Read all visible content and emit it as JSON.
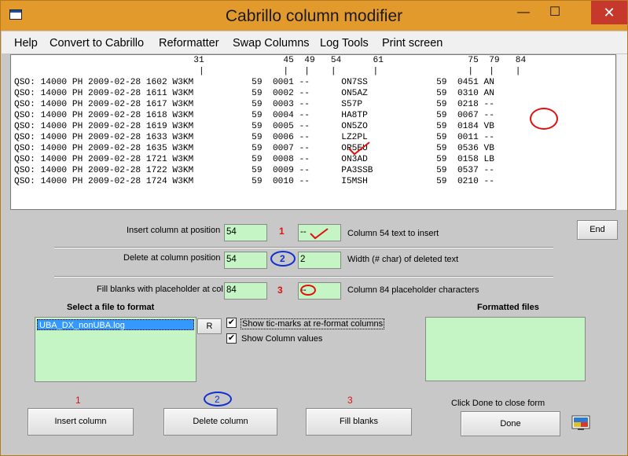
{
  "window": {
    "title": "Cabrillo column modifier",
    "minimize": "—",
    "maximize": "☐",
    "close": "✕"
  },
  "menu": [
    "Help",
    "Convert to Cabrillo",
    "Reformatter",
    "Swap Columns",
    "Log Tools",
    "Print screen"
  ],
  "log_header": [
    "                                  31               45  49   54      61                75  79   84",
    "                                   |               |   |    |       |                 |   |    |"
  ],
  "log_lines": [
    "QSO: 14000 PH 2009-02-28 1602 W3KM           59  0001 --      ON7SS             59  0451 AN",
    "QSO: 14000 PH 2009-02-28 1611 W3KM           59  0002 --      ON5AZ             59  0310 AN",
    "QSO: 14000 PH 2009-02-28 1617 W3KM           59  0003 --      S57P              59  0218 --",
    "QSO: 14000 PH 2009-02-28 1618 W3KM           59  0004 --      HA8TP             59  0067 --",
    "QSO: 14000 PH 2009-02-28 1619 W3KM           59  0005 --      ON5ZO             59  0184 VB",
    "QSO: 14000 PH 2009-02-28 1633 W3KM           59  0006 --      LZ2PL             59  0011 --",
    "QSO: 14000 PH 2009-02-28 1635 W3KM           59  0007 --      OR5EU             59  0536 VB",
    "QSO: 14000 PH 2009-02-28 1721 W3KM           59  0008 --      ON3AD             59  0158 LB",
    "QSO: 14000 PH 2009-02-28 1722 W3KM           59  0009 --      PA3SSB            59  0537 --",
    "QSO: 14000 PH 2009-02-28 1724 W3KM           59  0010 --      I5MSH             59  0210 --"
  ],
  "insert_row": {
    "label": "Insert column at position",
    "position": "54",
    "number": "1",
    "text_value": "--",
    "caption": "Column 54 text to insert"
  },
  "delete_row": {
    "label": "Delete at column position",
    "position": "54",
    "number": "2",
    "width_value": "2",
    "caption": "Width (# char) of deleted text"
  },
  "fill_row": {
    "label": "Fill blanks with placeholder at col",
    "position": "84",
    "number": "3",
    "placeholder_value": "--",
    "caption": "Column 84 placeholder characters"
  },
  "end_button": "End",
  "file_select": {
    "heading": "Select a file to format",
    "files": [
      "UBA_DX_nonUBA.log"
    ],
    "refresh_button": "R"
  },
  "options": {
    "show_tic_marks": {
      "label": "Show tic-marks at re-format columns",
      "checked": true,
      "mark": "✔"
    },
    "show_column_values": {
      "label": "Show Column values",
      "checked": true,
      "mark": "✔"
    }
  },
  "formatted_files": {
    "heading": "Formatted files",
    "files": []
  },
  "bottom": {
    "num1": "1",
    "num2": "2",
    "num3": "3",
    "insert_button": "Insert column",
    "delete_button": "Delete column",
    "fill_button": "Fill blanks",
    "done_hint": "Click Done to close form",
    "done_button": "Done"
  },
  "colors": {
    "title_bar": "#e39a2c",
    "field_green": "#c5f5c5",
    "annotation_red": "#e01010",
    "annotation_blue": "#1030d0"
  }
}
